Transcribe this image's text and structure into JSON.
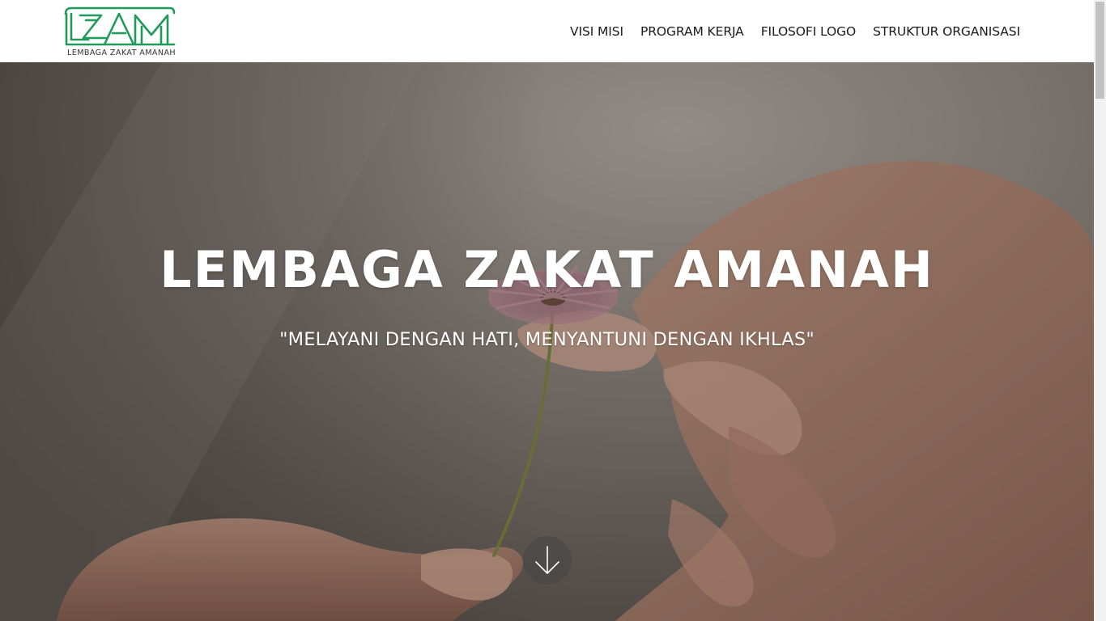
{
  "brand": {
    "logo_mark": "LZAM",
    "logo_text": "LEMBAGA ZAKAT AMANAH",
    "logo_color": "#1f9a5a"
  },
  "nav": {
    "items": [
      {
        "label": "VISI MISI"
      },
      {
        "label": "PROGRAM KERJA"
      },
      {
        "label": "FILOSOFI LOGO"
      },
      {
        "label": "STRUKTUR ORGANISASI"
      }
    ]
  },
  "hero": {
    "title": "LEMBAGA ZAKAT AMANAH",
    "tagline": "\"MELAYANI DENGAN HATI, MENYANTUNI DENGAN IKHLAS\"",
    "background_image": "hand giving a pink daisy flower to another hand",
    "scroll_icon": "arrow-down-icon"
  }
}
